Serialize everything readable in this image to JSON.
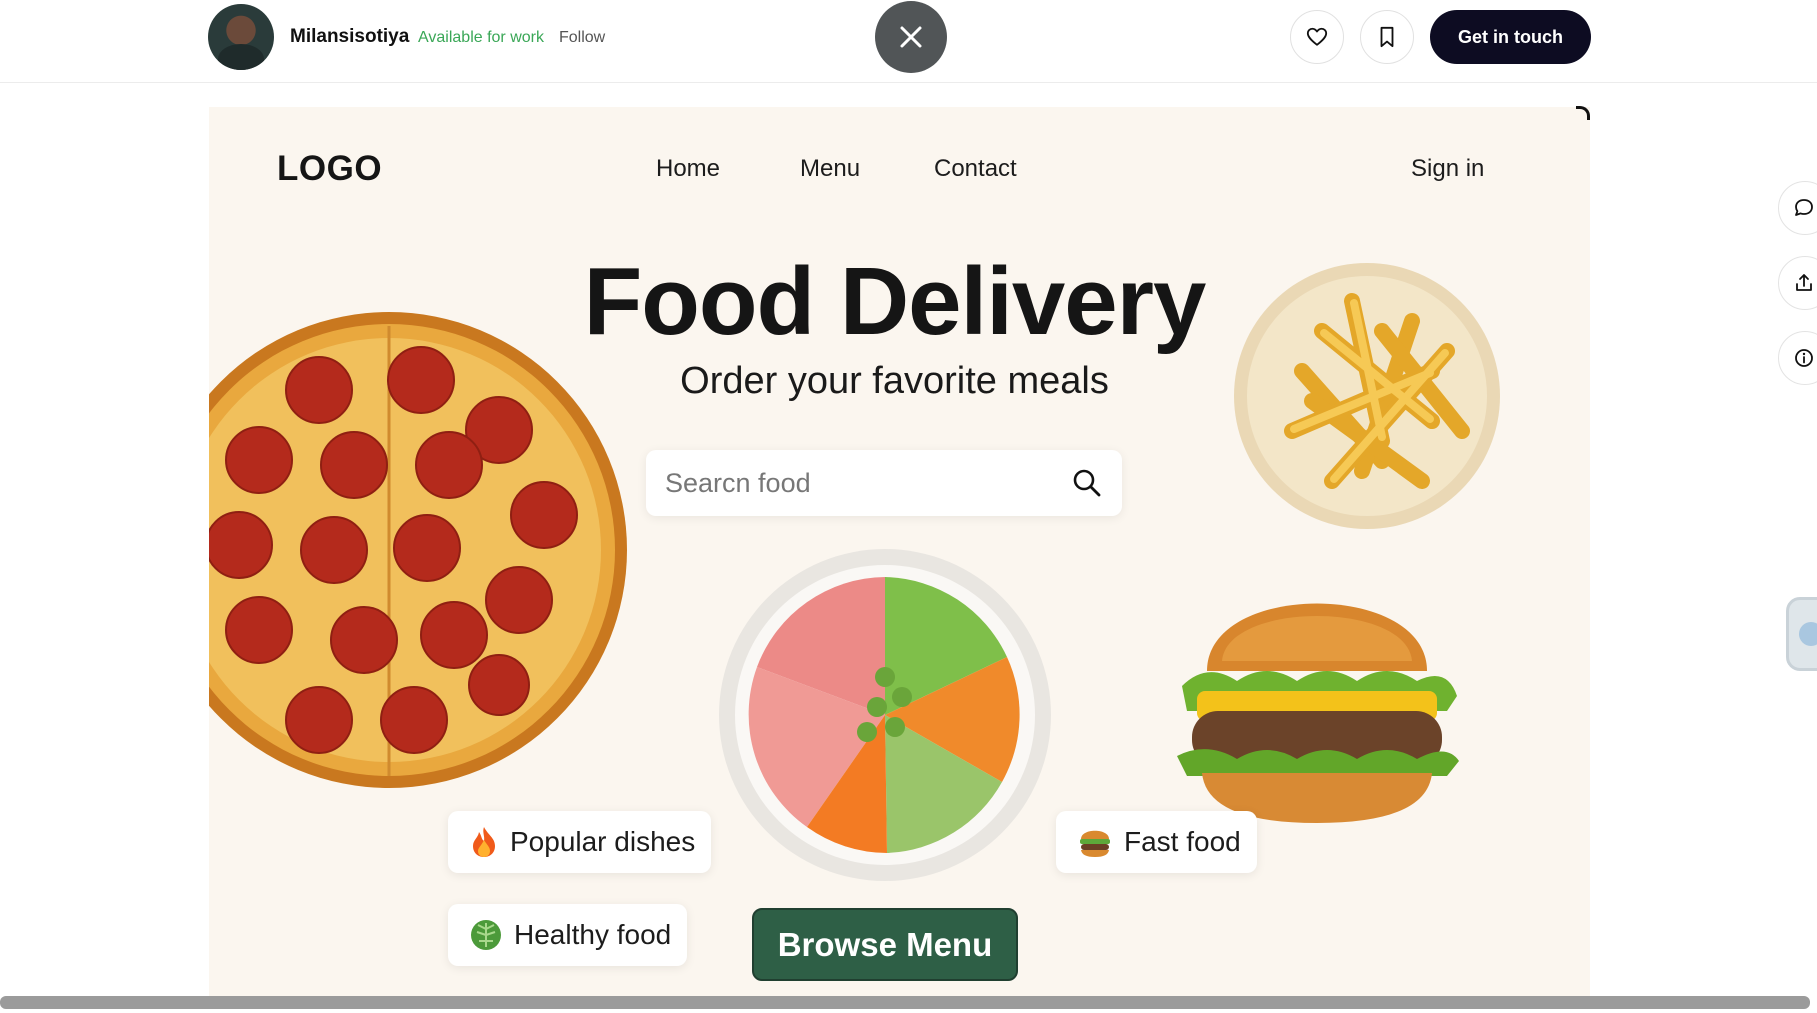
{
  "topbar": {
    "designer_name": "Milansisotiya",
    "availability": "Available for work",
    "follow_label": "Follow",
    "cta_label": "Get in touch"
  },
  "site": {
    "logo": "LOGO",
    "nav": [
      "Home",
      "Menu",
      "Contact"
    ],
    "sign_in": "Sign in",
    "hero_title": "Food Delivery",
    "hero_subtitle": "Order your favorite meals",
    "search_placeholder": "Searcn food",
    "pills": {
      "popular": "Popular dishes",
      "healthy": "Healthy food",
      "fast": "Fast food"
    },
    "browse_label": "Browse Menu"
  },
  "colors": {
    "canvas_bg": "#fbf6ef",
    "cta_bg": "#0d0c22",
    "available_green": "#3aa757",
    "browse_green": "#2e5f46"
  }
}
